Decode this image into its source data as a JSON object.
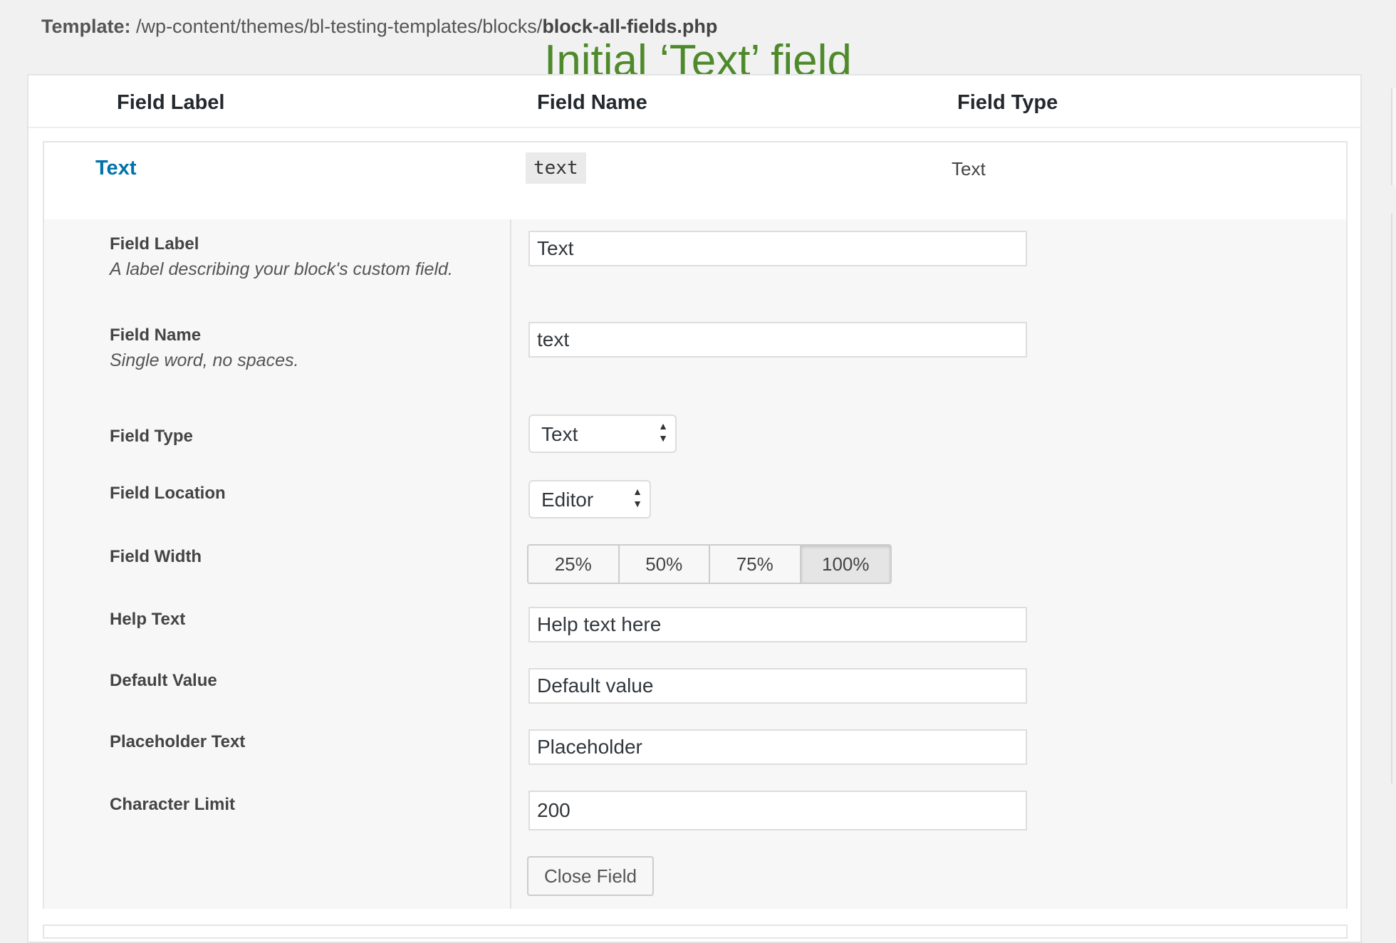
{
  "template": {
    "prefix": "Template:",
    "path": "/wp-content/themes/bl-testing-templates/blocks/",
    "file": "block-all-fields.php"
  },
  "annotation": "Initial ‘Text’ field",
  "columns": {
    "label": "Field Label",
    "name": "Field Name",
    "type": "Field Type"
  },
  "field": {
    "label": "Text",
    "name": "text",
    "type": "Text"
  },
  "settings": {
    "field_label": {
      "label": "Field Label",
      "desc": "A label describing your block's custom field.",
      "value": "Text"
    },
    "field_name": {
      "label": "Field Name",
      "desc": "Single word, no spaces.",
      "value": "text"
    },
    "field_type": {
      "label": "Field Type",
      "value": "Text"
    },
    "field_location": {
      "label": "Field Location",
      "value": "Editor"
    },
    "field_width": {
      "label": "Field Width",
      "options": [
        "25%",
        "50%",
        "75%",
        "100%"
      ],
      "selected": "100%"
    },
    "help_text": {
      "label": "Help Text",
      "value": "Help text here"
    },
    "default_value": {
      "label": "Default Value",
      "value": "Default value"
    },
    "placeholder": {
      "label": "Placeholder Text",
      "value": "Placeholder"
    },
    "char_limit": {
      "label": "Character Limit",
      "value": "200"
    },
    "close_label": "Close Field"
  },
  "colors": {
    "accent_link": "#0073aa",
    "annotation": "#4e8a2b"
  }
}
